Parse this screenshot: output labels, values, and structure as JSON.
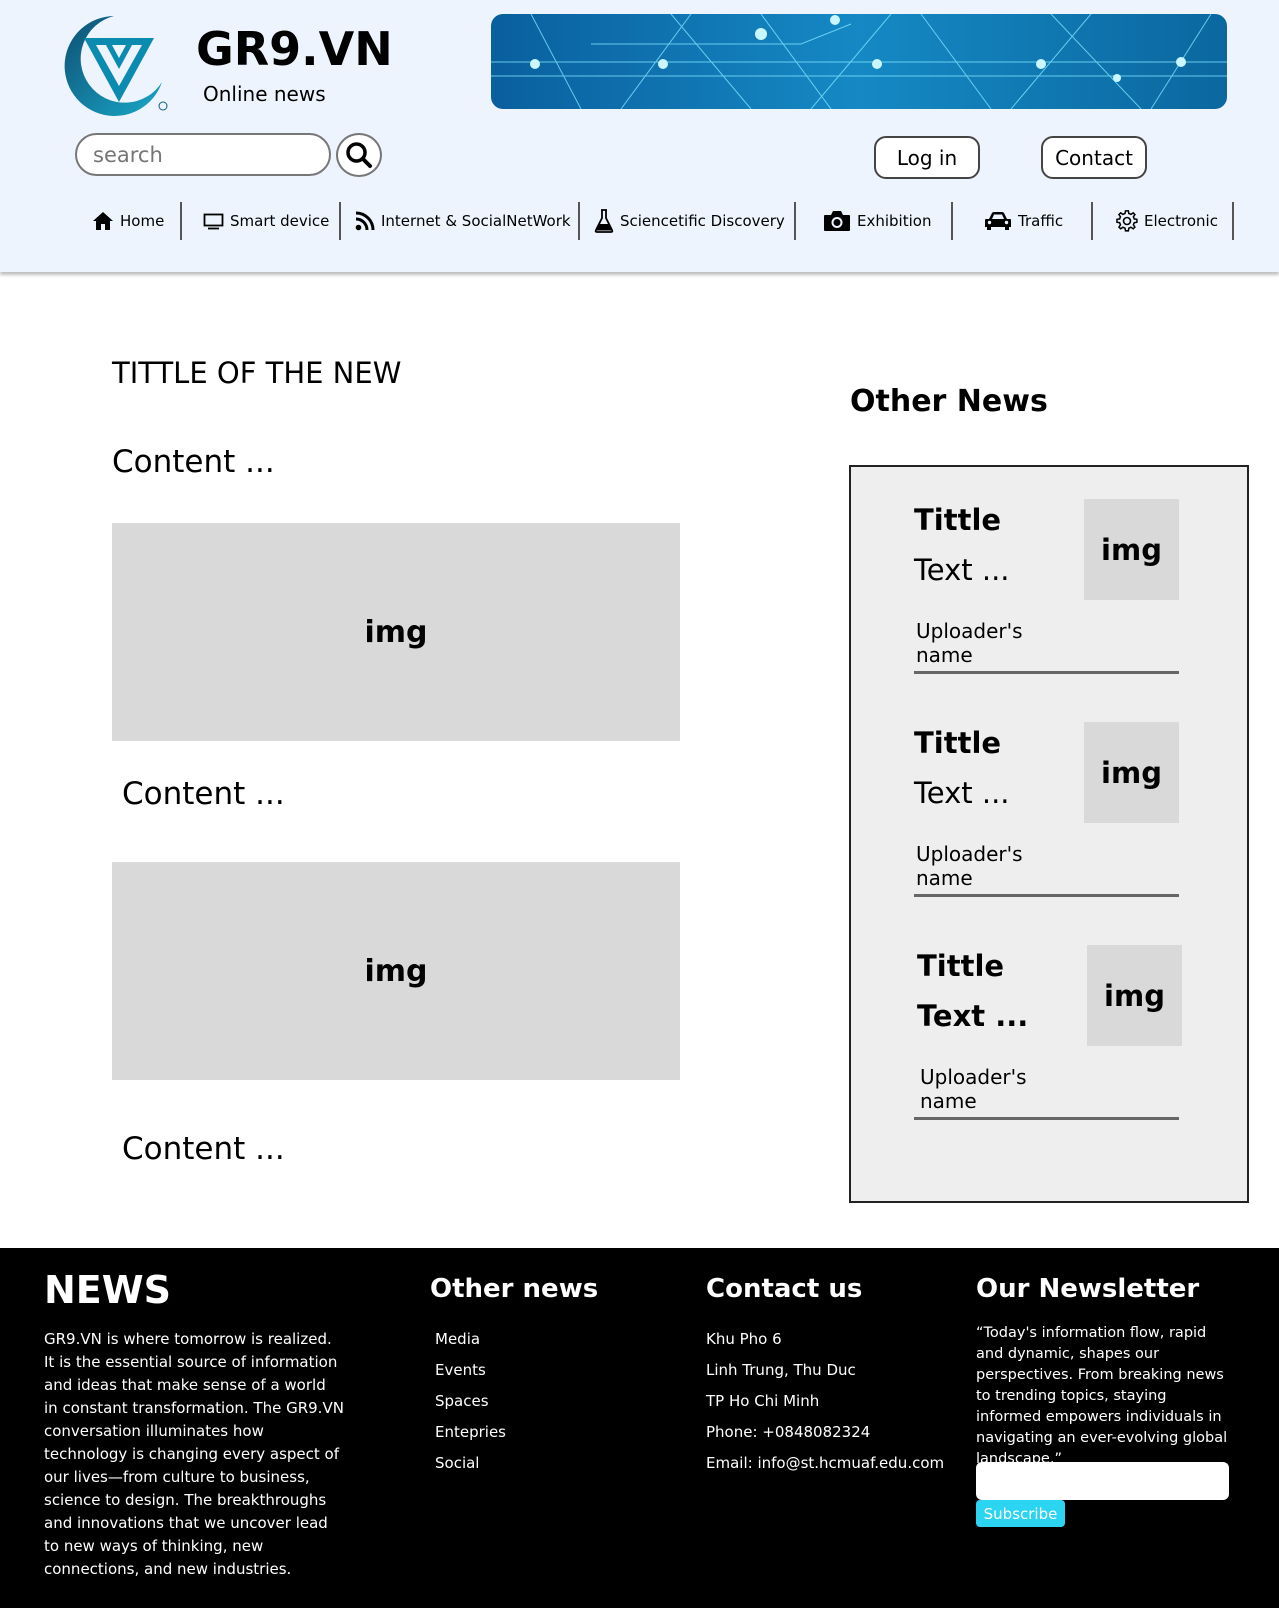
{
  "brand": {
    "name": "GR9.VN",
    "tagline": "Online news",
    "logo_icon": "v-shield-logo-icon",
    "colors": {
      "header_bg": "#eef4fd",
      "logo_teal": "#0c8bb0",
      "banner_blue": "#1589c4"
    }
  },
  "header": {
    "search_placeholder": "search",
    "login_label": "Log in",
    "contact_label": "Contact"
  },
  "nav": {
    "items": [
      {
        "label": "Home",
        "icon": "home-icon"
      },
      {
        "label": "Smart device",
        "icon": "monitor-icon"
      },
      {
        "label": "Internet & SocialNetWork",
        "icon": "rss-icon"
      },
      {
        "label": "Sciencetific Discovery",
        "icon": "flask-icon"
      },
      {
        "label": "Exhibition",
        "icon": "camera-icon"
      },
      {
        "label": "Traffic",
        "icon": "car-icon"
      },
      {
        "label": "Electronic",
        "icon": "gear-icon"
      }
    ]
  },
  "article": {
    "title": "TITTLE OF THE NEW",
    "contents": [
      "Content ...",
      "Content ...",
      "Content ..."
    ],
    "img_labels": [
      "img",
      "img"
    ]
  },
  "other_news": {
    "heading": "Other News",
    "items": [
      {
        "title": "Tittle",
        "text": "Text ...",
        "img": "img",
        "uploader": "Uploader's name"
      },
      {
        "title": "Tittle",
        "text": "Text ...",
        "img": "img",
        "uploader": "Uploader's name"
      },
      {
        "title": "Tittle",
        "text": "Text ...",
        "img": "img",
        "uploader": "Uploader's name"
      }
    ]
  },
  "footer": {
    "brand": "NEWS",
    "about": "GR9.VN is where tomorrow is realized. It is the essential source of information and ideas that make sense of a world in constant transformation. The GR9.VN conversation illuminates how technology is changing every aspect of our lives—from culture to business, science to design. The breakthroughs and innovations that we uncover lead to new ways of thinking, new connections, and new industries.",
    "other_news": {
      "heading": "Other news",
      "links": [
        "Media",
        "Events",
        "Spaces",
        "Entepries",
        "Social"
      ]
    },
    "contact": {
      "heading": "Contact us",
      "lines": [
        "Khu Pho 6",
        "Linh Trung, Thu Duc",
        "TP Ho Chi Minh",
        "Phone: +0848082324",
        "Email: info@st.hcmuaf.edu.com"
      ]
    },
    "newsletter": {
      "heading": "Our Newsletter",
      "quote": "“Today's information flow, rapid and dynamic, shapes our perspectives. From breaking news to trending topics, staying informed empowers individuals in navigating an ever-evolving global landscape.”",
      "subscribe_label": "Subscribe",
      "button_color": "#2bd4f0"
    }
  }
}
